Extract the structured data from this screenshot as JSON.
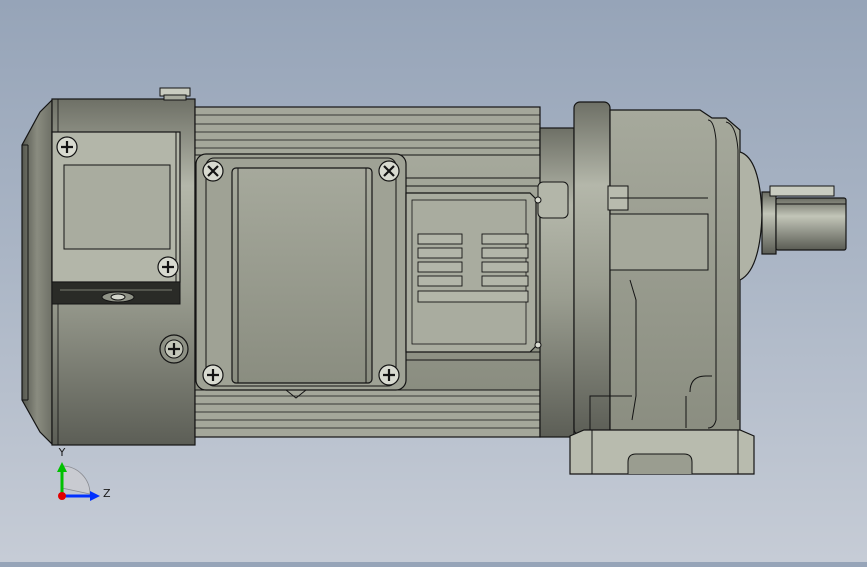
{
  "viewport": {
    "background_top": "#96a4b8",
    "background_bottom": "#c6ccd6",
    "model_color": "#9a9d90",
    "edge_color": "#141414"
  },
  "triad": {
    "y_label": "Y",
    "z_label": "Z",
    "y_color": "#00c000",
    "z_color": "#0030ff",
    "x_color": "#e00000"
  },
  "icons": {
    "screws": "phillips-screw-icon",
    "drain_plug": "phillips-plug-icon"
  }
}
